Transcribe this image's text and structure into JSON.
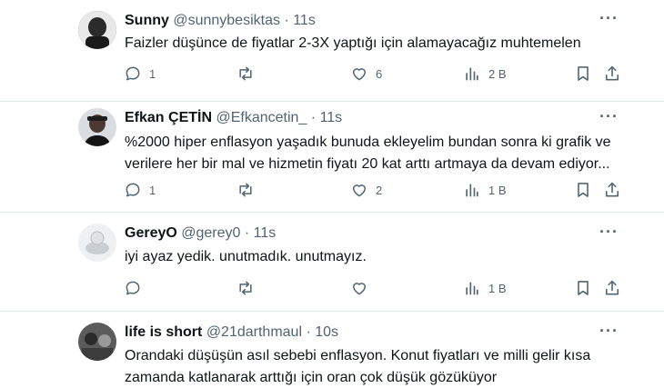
{
  "tweets": [
    {
      "name": "Sunny",
      "handle": "@sunnybesiktas",
      "dot": "·",
      "time": "11s",
      "lines": [
        "Faizler düşünce de fiyatlar 2-3X yaptığı için alamayacağız muhtemelen"
      ],
      "replies": "1",
      "retweets": "",
      "likes": "6",
      "views": "2 B"
    },
    {
      "name": "Efkan ÇETİN",
      "handle": "@Efkancetin_",
      "dot": "·",
      "time": "11s",
      "lines": [
        "%2000 hiper enflasyon yaşadık bunuda ekleyelim bundan sonra ki grafik ve",
        "verilere her bir mal ve hizmetin fiyatı 20 kat arttı artmaya da devam ediyor..."
      ],
      "replies": "1",
      "retweets": "",
      "likes": "2",
      "views": "1 B"
    },
    {
      "name": "GereyO",
      "handle": "@gerey0",
      "dot": "·",
      "time": "11s",
      "lines": [
        "iyi ayaz yedik. unutmadık. unutmayız."
      ],
      "replies": "",
      "retweets": "",
      "likes": "",
      "views": "1 B"
    },
    {
      "name": "life is short",
      "handle": "@21darthmaul",
      "dot": "·",
      "time": "10s",
      "lines": [
        "Orandaki düşüşün asıl sebebi enflasyon. Konut fiyatları ve milli gelir kısa",
        "zamanda katlanarak arttığı için oran çok düşük gözüküyor"
      ],
      "replies": "",
      "retweets": "",
      "likes": "",
      "views": ""
    }
  ],
  "more_glyph": "···",
  "colors": {
    "text": "#0f1419",
    "secondary": "#536471",
    "separator": "#e1e8ed"
  }
}
